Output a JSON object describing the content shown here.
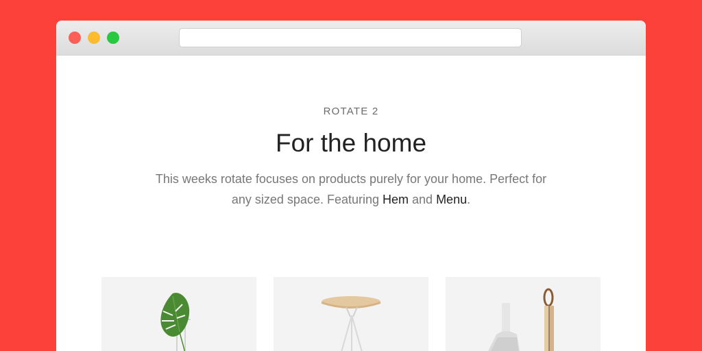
{
  "window": {
    "url": ""
  },
  "hero": {
    "eyebrow": "ROTATE 2",
    "title": "For the home",
    "desc_text": "This weeks rotate focuses on products purely for your home. Perfect for any sized space. Featuring ",
    "link_hem": "Hem",
    "and_text": " and ",
    "link_menu": "Menu",
    "period": "."
  },
  "products": [
    {
      "icon": "monstera-plant-icon"
    },
    {
      "icon": "side-table-icon"
    },
    {
      "icon": "dustpan-brush-icon"
    }
  ]
}
